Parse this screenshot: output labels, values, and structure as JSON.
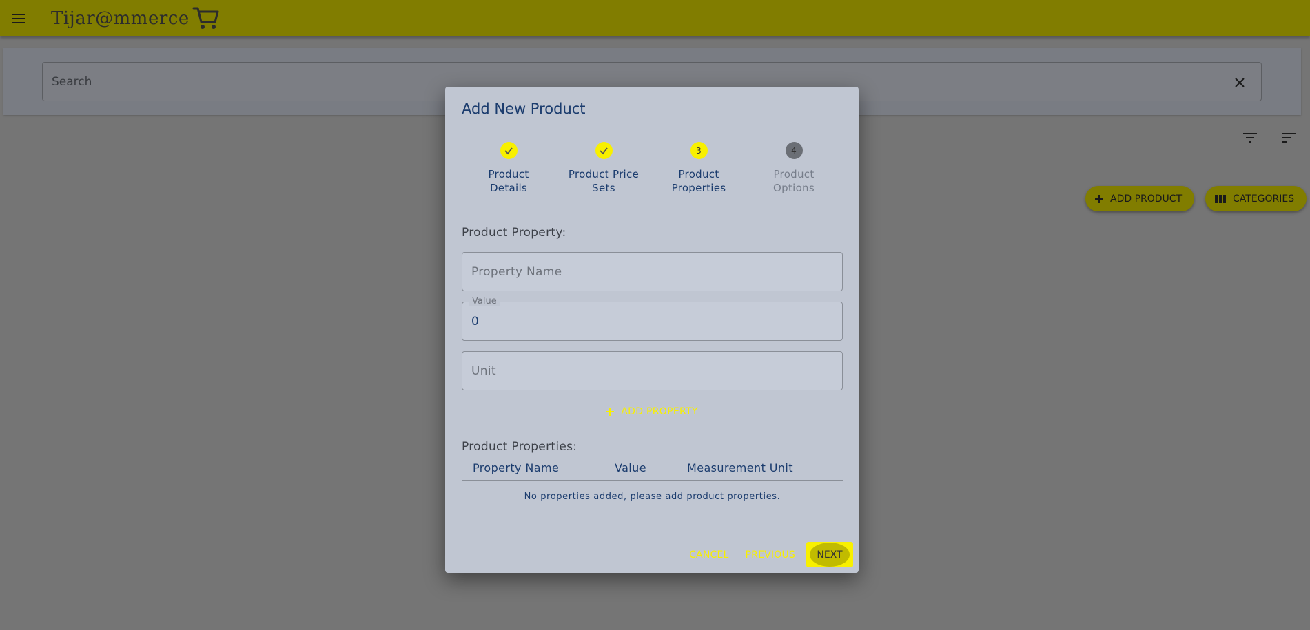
{
  "app": {
    "brand": "Tijar@mmerce",
    "search_placeholder": "Search",
    "add_product_label": "ADD PRODUCT",
    "categories_label": "CATEGORIES"
  },
  "colors": {
    "primary": "#f8f000",
    "title_blue": "#1b3c6e"
  },
  "dialog": {
    "title": "Add New Product",
    "steps": [
      {
        "marker": "",
        "label_line1": "Product",
        "label_line2": "Details",
        "state": "done"
      },
      {
        "marker": "",
        "label_line1": "Product Price",
        "label_line2": "Sets",
        "state": "done"
      },
      {
        "marker": "3",
        "label_line1": "Product",
        "label_line2": "Properties",
        "state": "active"
      },
      {
        "marker": "4",
        "label_line1": "Product",
        "label_line2": "Options",
        "state": "todo"
      }
    ],
    "property_section_label": "Product Property:",
    "property_name_placeholder": "Property Name",
    "value_label": "Value",
    "value_value": "0",
    "unit_placeholder": "Unit",
    "add_property_label": "ADD PROPERTY",
    "properties_section_label": "Product Properties:",
    "table_headers": [
      "Property Name",
      "Value",
      "Measurement Unit"
    ],
    "empty_message": "No properties added, please add product properties.",
    "cancel_label": "CANCEL",
    "previous_label": "PREVIOUS",
    "next_label": "NEXT"
  }
}
